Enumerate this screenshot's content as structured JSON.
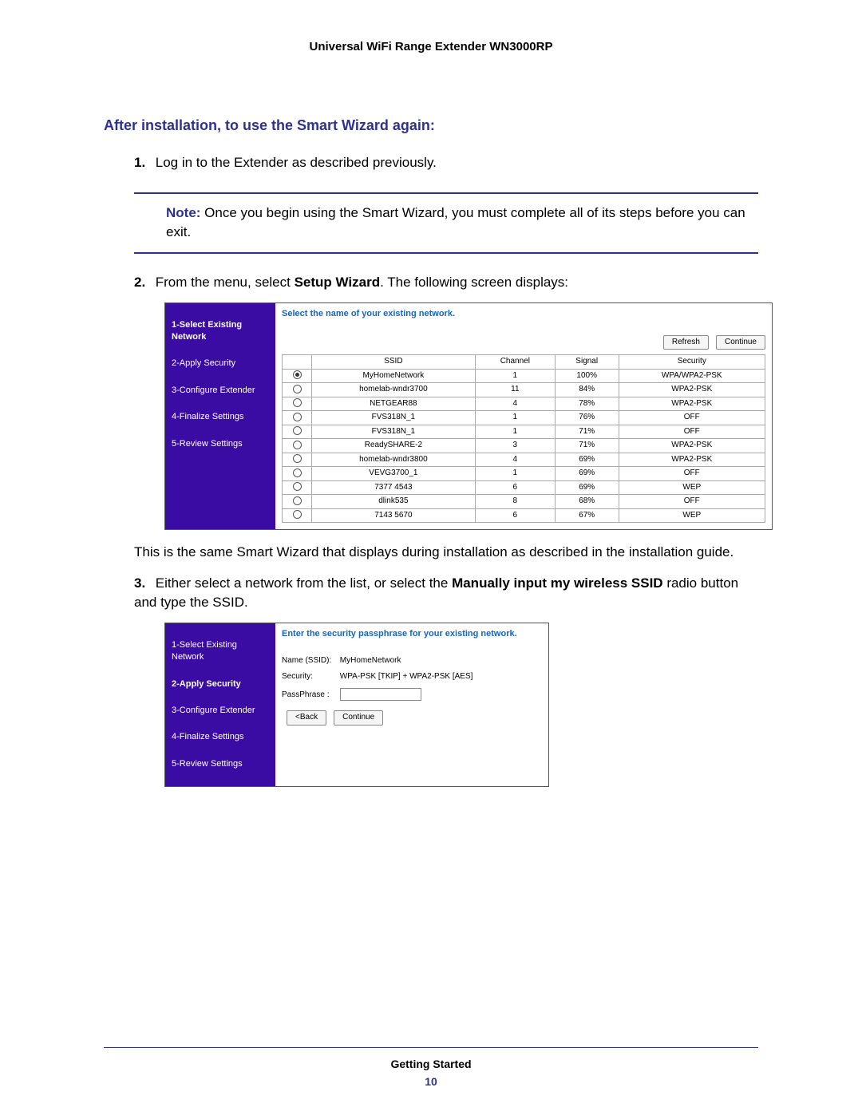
{
  "header": "Universal WiFi Range Extender WN3000RP",
  "section_title": "After installation, to use the Smart Wizard again:",
  "steps": {
    "s1_num": "1.",
    "s1_text": "Log in to the Extender as described previously.",
    "note_label": "Note:",
    "note_text": "  Once you begin using the Smart Wizard, you must complete all of its steps before you can exit.",
    "s2_num": "2.",
    "s2_a": "From the menu, select ",
    "s2_b": "Setup Wizard",
    "s2_c": ". The following screen displays:",
    "s2_after": "This is the same Smart Wizard that displays during installation as described in the installation guide.",
    "s3_num": "3.",
    "s3_a": "Either select a network from the list, or select the ",
    "s3_b": "Manually input my wireless SSID",
    "s3_c": " radio button and type the SSID."
  },
  "shot1": {
    "prompt": "Select the name of your existing network.",
    "btn_refresh": "Refresh",
    "btn_continue": "Continue",
    "sidebar": {
      "s1": "1-Select Existing Network",
      "s2": "2-Apply Security",
      "s3": "3-Configure Extender",
      "s4": "4-Finalize Settings",
      "s5": "5-Review Settings"
    },
    "headers": {
      "ssid": "SSID",
      "channel": "Channel",
      "signal": "Signal",
      "security": "Security"
    },
    "rows": [
      {
        "checked": true,
        "ssid": "MyHomeNetwork",
        "ch": "1",
        "sig": "100%",
        "sec": "WPA/WPA2-PSK"
      },
      {
        "checked": false,
        "ssid": "homelab-wndr3700",
        "ch": "11",
        "sig": "84%",
        "sec": "WPA2-PSK"
      },
      {
        "checked": false,
        "ssid": "NETGEAR88",
        "ch": "4",
        "sig": "78%",
        "sec": "WPA2-PSK"
      },
      {
        "checked": false,
        "ssid": "FVS318N_1",
        "ch": "1",
        "sig": "76%",
        "sec": "OFF"
      },
      {
        "checked": false,
        "ssid": "FVS318N_1",
        "ch": "1",
        "sig": "71%",
        "sec": "OFF"
      },
      {
        "checked": false,
        "ssid": "ReadySHARE-2",
        "ch": "3",
        "sig": "71%",
        "sec": "WPA2-PSK"
      },
      {
        "checked": false,
        "ssid": "homelab-wndr3800",
        "ch": "4",
        "sig": "69%",
        "sec": "WPA2-PSK"
      },
      {
        "checked": false,
        "ssid": "VEVG3700_1",
        "ch": "1",
        "sig": "69%",
        "sec": "OFF"
      },
      {
        "checked": false,
        "ssid": "7377 4543",
        "ch": "6",
        "sig": "69%",
        "sec": "WEP"
      },
      {
        "checked": false,
        "ssid": "dlink535",
        "ch": "8",
        "sig": "68%",
        "sec": "OFF"
      },
      {
        "checked": false,
        "ssid": "7143 5670",
        "ch": "6",
        "sig": "67%",
        "sec": "WEP"
      }
    ]
  },
  "shot2": {
    "prompt": "Enter the security passphrase for your existing network.",
    "name_label": "Name (SSID):",
    "name_value": "MyHomeNetwork",
    "sec_label": "Security:",
    "sec_value": "WPA-PSK [TKIP] + WPA2-PSK [AES]",
    "pass_label": "PassPhrase :",
    "btn_back": "<Back",
    "btn_continue": "Continue",
    "sidebar": {
      "s1": "1-Select Existing Network",
      "s2": "2-Apply Security",
      "s3": "3-Configure Extender",
      "s4": "4-Finalize Settings",
      "s5": "5-Review Settings"
    }
  },
  "footer": {
    "title": "Getting Started",
    "page": "10"
  }
}
